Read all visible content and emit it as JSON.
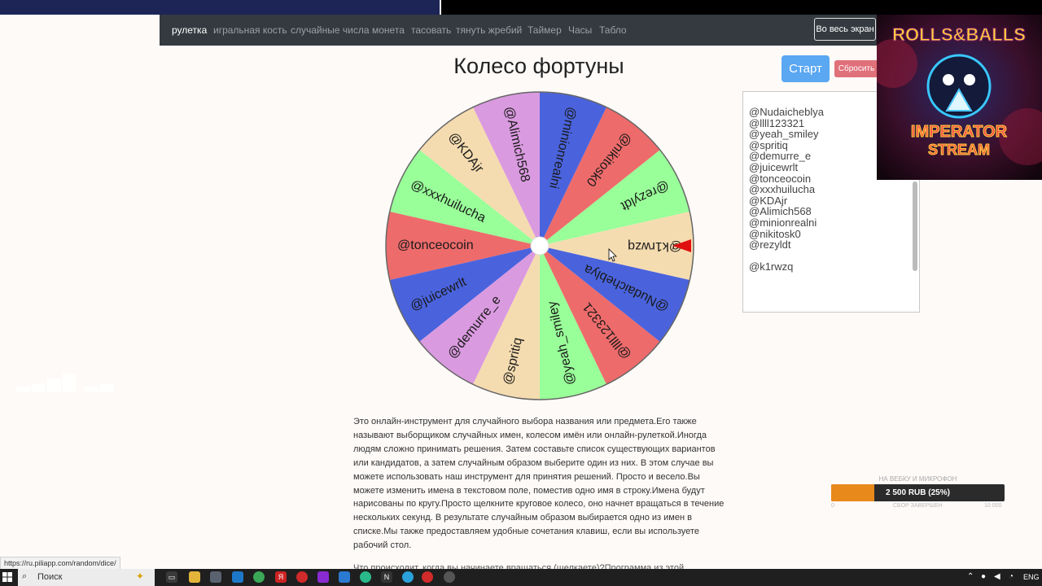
{
  "nav": {
    "items": [
      "рулетка",
      "игральная кость",
      "случайные числа",
      "монета",
      "тасовать",
      "тянуть жребий",
      "Таймер",
      "Часы",
      "Табло"
    ],
    "fullscreen_label": "Во весь экран"
  },
  "title": "Колесо фортуны",
  "buttons": {
    "start": "Старт",
    "reset": "Сбросить"
  },
  "names": [
    "@Nudaicheblya",
    "@llll123321",
    "@yeah_smiley",
    "@spritiq",
    "@demurre_e",
    "@juicewrlt",
    "@tonceocoin",
    "@xxxhuilucha",
    "@KDAjr",
    "@Alimich568",
    "@minionrealni",
    "@nikitosk0",
    "@rezyldt",
    "",
    "@k1rwzq"
  ],
  "wheel": {
    "segments": [
      {
        "label": "@rezyldt",
        "color": "#99ff99"
      },
      {
        "label": "@nikitosk0",
        "color": "#ee6b6b"
      },
      {
        "label": "@minionrealni",
        "color": "#4a63dd"
      },
      {
        "label": "@Alimich568",
        "color": "#da9ae0"
      },
      {
        "label": "@KDAjr",
        "color": "#f5dcb0"
      },
      {
        "label": "@xxxhuilucha",
        "color": "#99ff99"
      },
      {
        "label": "@tonceocoin",
        "color": "#ee6b6b"
      },
      {
        "label": "@juicewrlt",
        "color": "#4a63dd"
      },
      {
        "label": "@demurre_e",
        "color": "#da9ae0"
      },
      {
        "label": "@spritiq",
        "color": "#f5dcb0"
      },
      {
        "label": "@yeah_smiley",
        "color": "#99ff99"
      },
      {
        "label": "@llll123321",
        "color": "#ee6b6b"
      },
      {
        "label": "@Nudaicheblya",
        "color": "#4a63dd"
      },
      {
        "label": "@k1rwzq",
        "color": "#f5dcb0"
      }
    ],
    "pointer_color": "#e01010"
  },
  "description": "Это онлайн-инструмент для случайного выбора названия или предмета.Его также называют выборщиком случайных имен, колесом имён или онлайн-рулеткой.Иногда людям сложно принимать решения. Затем составьте список существующих вариантов или кандидатов, а затем случайным образом выберите один из них. В этом случае вы можете использовать наш инструмент для принятия решений. Просто и весело.Вы можете изменить имена в текстовом поле, поместив одно имя в строку.Имена будут нарисованы по кругу.Просто щелкните круговое колесо, оно начнет вращаться в течение нескольких секунд. В результате случайным образом выбирается одно из имен в списке.Мы также предоставляем удобные сочетания клавиш, если вы используете рабочий стол.",
  "description_next": "Что происходит, когда вы начинаете вращаться (щелкаете)?Программа из этой",
  "overlay": {
    "logo_line1": "ROLLS&BALLS",
    "logo_line2": "IMPERATOR",
    "logo_line3": "STREAM",
    "donation_title": "НА ВЕБКУ И МИКРОФОН",
    "donation_text": "2 500 RUB (25%)",
    "donation_percent": 25,
    "donation_min": "0",
    "donation_status": "СБОР ЗАВЕРШЕН",
    "donation_max": "10 000"
  },
  "status_url": "https://ru.piliapp.com/random/dice/",
  "taskbar": {
    "search_label": "Поиск",
    "lang": "ENG"
  },
  "colors": {
    "navbar": "#343a40",
    "start": "#5aa7f2",
    "reset": "#e0707a",
    "donation_fill": "#e8891c"
  }
}
